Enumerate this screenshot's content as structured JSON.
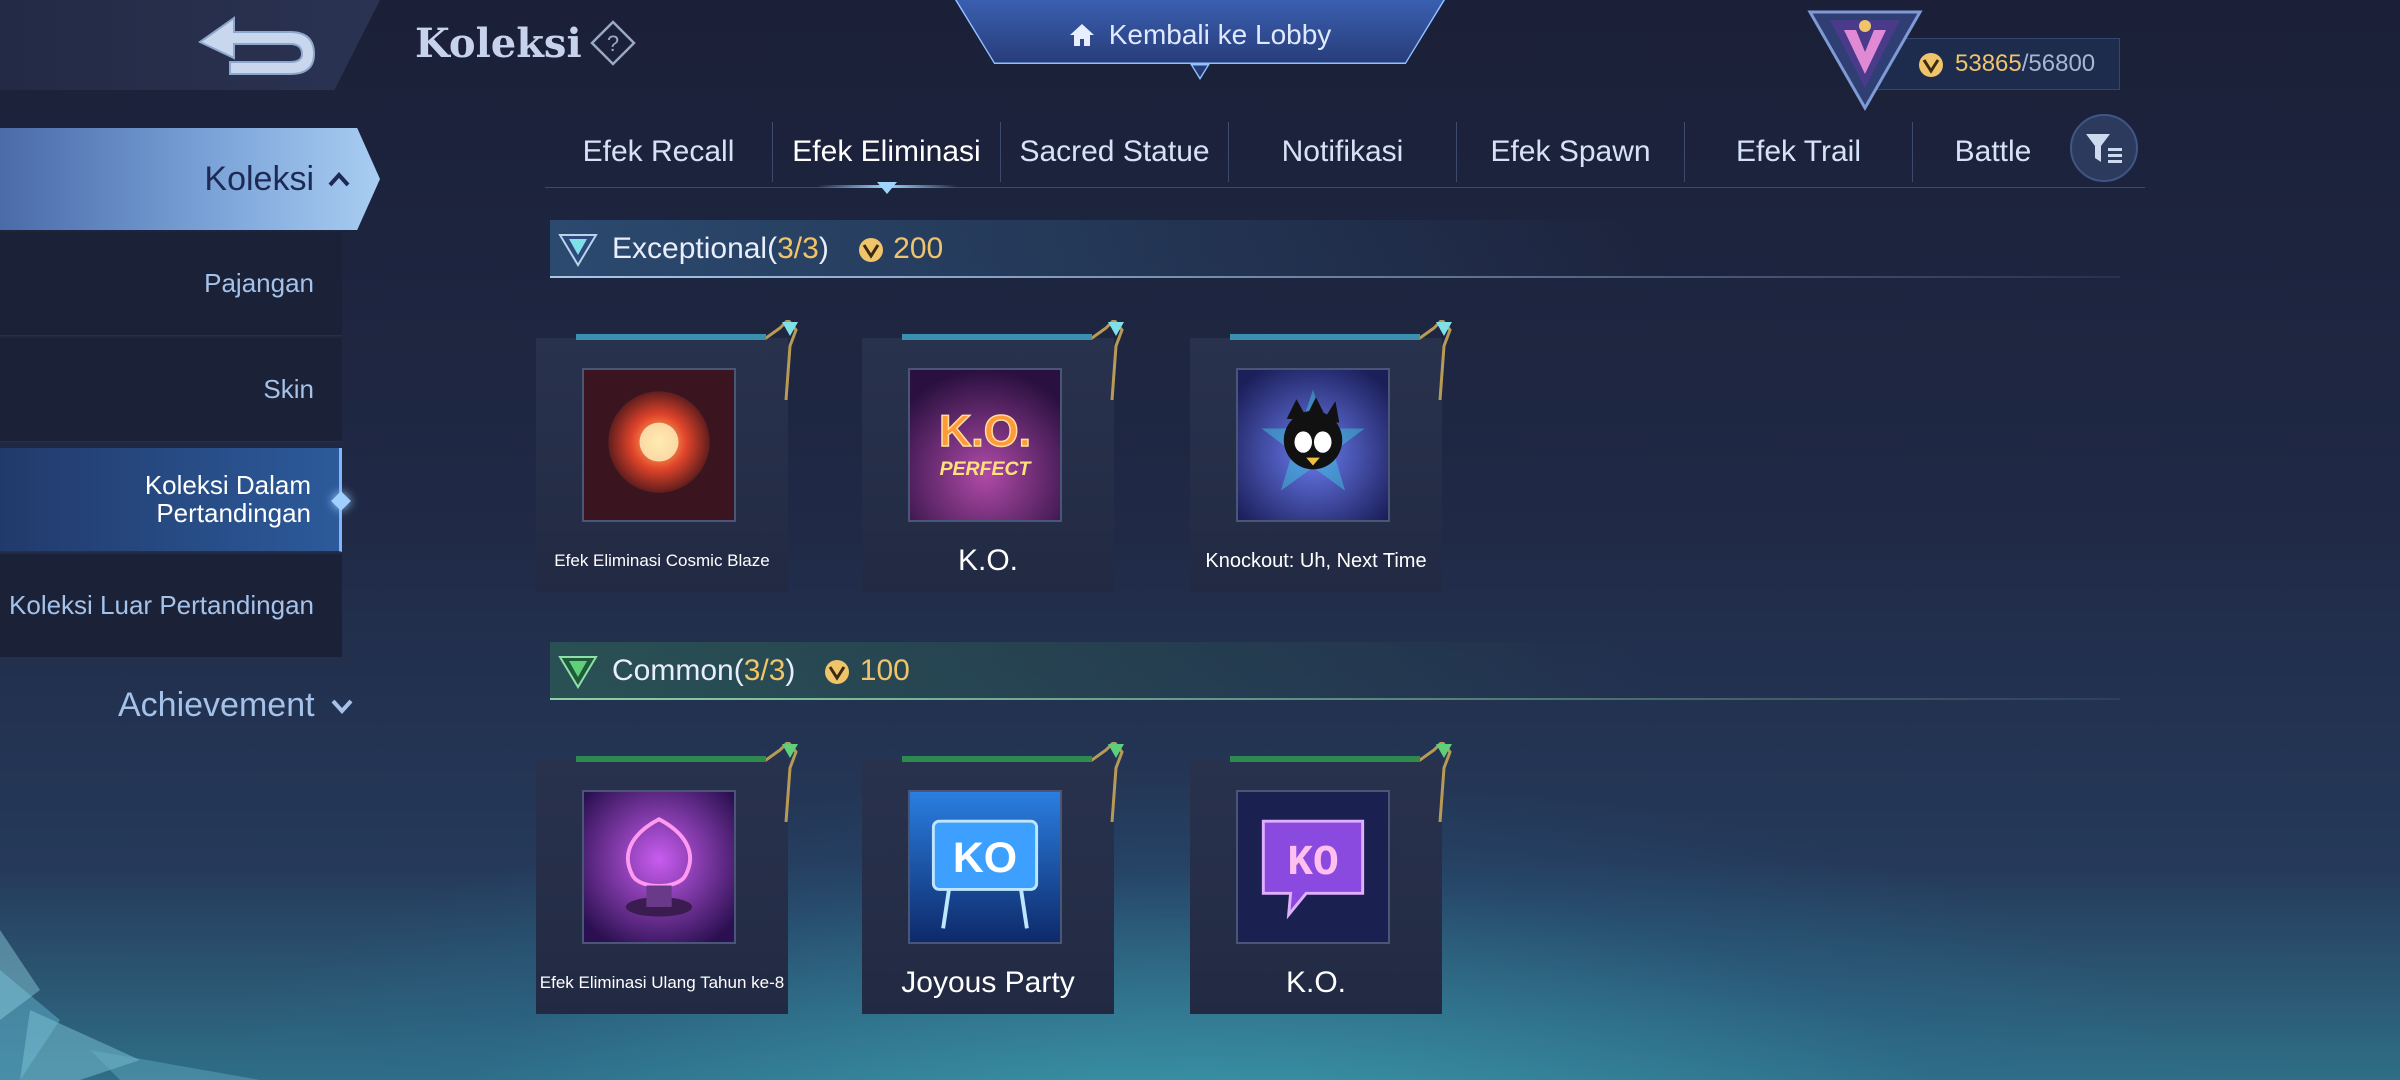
{
  "header": {
    "title": "Koleksi",
    "lobby_label": "Kembali ke Lobby",
    "points_current": "53865",
    "points_max": "/56800"
  },
  "sidebar": {
    "main_label": "Koleksi",
    "items": [
      {
        "label": "Pajangan"
      },
      {
        "label": "Skin"
      },
      {
        "label": "Koleksi Dalam Pertandingan"
      },
      {
        "label": "Koleksi Luar Pertandingan"
      }
    ],
    "achievement_label": "Achievement"
  },
  "tabs": [
    {
      "label": "Efek Recall"
    },
    {
      "label": "Efek Eliminasi"
    },
    {
      "label": "Sacred Statue"
    },
    {
      "label": "Notifikasi"
    },
    {
      "label": "Efek Spawn"
    },
    {
      "label": "Efek Trail"
    },
    {
      "label": "Battle"
    }
  ],
  "sections": {
    "exceptional": {
      "name": "Exceptional(",
      "owned": "3/3",
      "close": ")",
      "points": "200",
      "items": [
        {
          "name": "Efek Eliminasi Cosmic Blaze"
        },
        {
          "name": "K.O."
        },
        {
          "name": "Knockout: Uh, Next Time"
        }
      ]
    },
    "common": {
      "name": "Common(",
      "owned": "3/3",
      "close": ")",
      "points": "100",
      "items": [
        {
          "name": "Efek Eliminasi Ulang Tahun ke-8"
        },
        {
          "name": "Joyous Party"
        },
        {
          "name": "K.O."
        }
      ]
    }
  },
  "thumbnail_text": {
    "ko": "K.O.",
    "perfect": "PERFECT",
    "ko_short": "KO"
  },
  "colors": {
    "accent_gold": "#f0c46a",
    "nav_active": "#7aa2d8",
    "exceptional": "#a7c8e8",
    "common": "#5fbf7a"
  }
}
